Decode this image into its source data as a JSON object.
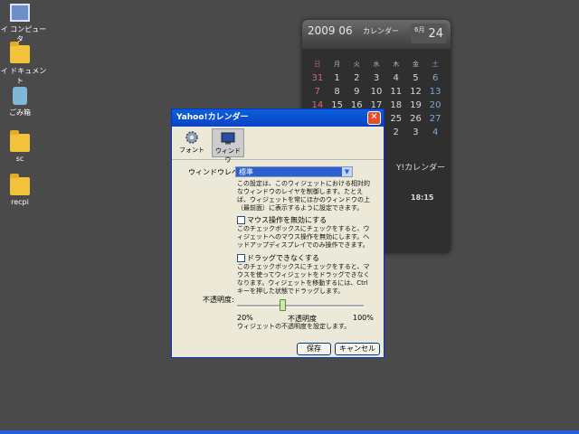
{
  "desktop": {
    "icons": [
      {
        "label": "マイ コンピュータ",
        "icon": "computer-icon"
      },
      {
        "label": "マイ ドキュメント",
        "icon": "documents-folder-icon"
      },
      {
        "label": "ごみ箱",
        "icon": "recycle-bin-icon"
      },
      {
        "label": "sc",
        "icon": "folder-icon"
      },
      {
        "label": "recpi",
        "icon": "folder-icon"
      }
    ]
  },
  "gadget": {
    "year_month": "2009 06",
    "calendar_label": "カレンダー",
    "month_badge": "6月",
    "weekday_badge": "水",
    "day": "24",
    "dow": [
      "日",
      "月",
      "火",
      "水",
      "木",
      "金",
      "土"
    ],
    "weeks": [
      [
        "31",
        "1",
        "2",
        "3",
        "4",
        "5",
        "6"
      ],
      [
        "7",
        "8",
        "9",
        "10",
        "11",
        "12",
        "13"
      ],
      [
        "14",
        "15",
        "16",
        "17",
        "18",
        "19",
        "20"
      ],
      [
        "21",
        "22",
        "23",
        "24",
        "25",
        "26",
        "27"
      ],
      [
        "28",
        "29",
        "30",
        "1",
        "2",
        "3",
        "4"
      ]
    ],
    "brand": "Y!カレンダー",
    "time": "18:15"
  },
  "dialog": {
    "title": "Yahoo!カレンダー",
    "tabs": [
      {
        "label": "フォント"
      },
      {
        "label": "ウィンドウ"
      }
    ],
    "window_level_label": "ウィンドウレベル:",
    "window_level_value": "標準",
    "window_level_desc": "この設定は、このウィジェットにおける相対的なウィンドウのレイヤを制御します。たとえば、ウィジェットを常にほかのウィンドウの上（最前面）に表示するように設定できます。",
    "mouse_disable_label": "マウス操作を無効にする",
    "mouse_disable_desc": "このチェックボックスにチェックをすると、ウィジェットへのマウス操作を無効にします。ヘッドアップディスプレイでのみ操作できます。",
    "no_drag_label": "ドラッグできなくする",
    "no_drag_desc": "このチェックボックスにチェックをすると、マウスを使ってウィジェットをドラッグできなくなります。ウィジェットを移動するには、Ctrlキーを押した状態でドラッグします。",
    "opacity_label": "不透明度:",
    "opacity_value": 0.35,
    "opacity_min": "20%",
    "opacity_mid": "不透明度",
    "opacity_max": "100%",
    "opacity_desc": "ウィジェットの不透明度を設定します。",
    "save_label": "保存",
    "cancel_label": "キャンセル",
    "close_label": "✕"
  }
}
